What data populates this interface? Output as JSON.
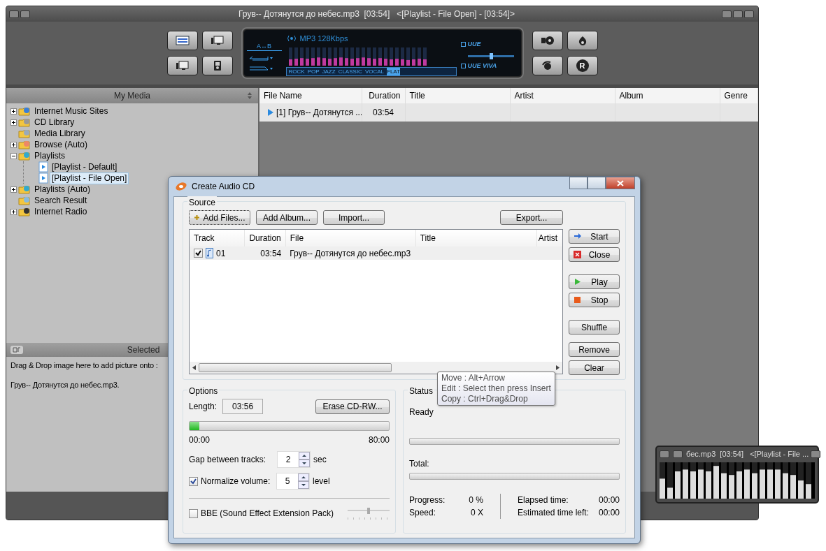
{
  "main_window": {
    "title": "Грув-- Дотянутся до небес.mp3  [03:54]   <[Playlist - File Open] - [03:54]>"
  },
  "player": {
    "format": "MP3 128Kbps",
    "ab_repeat": "A↔B",
    "presets": [
      {
        "label": "ROCK",
        "selected": false
      },
      {
        "label": "POP",
        "selected": false
      },
      {
        "label": "JAZZ",
        "selected": false
      },
      {
        "label": "CLASSIC",
        "selected": false
      },
      {
        "label": "VOCAL",
        "selected": false
      },
      {
        "label": "FLAT",
        "selected": true
      }
    ],
    "effects": [
      {
        "label": "UUE",
        "checked": false,
        "level": 0.5
      },
      {
        "label": "UUE VIVA",
        "checked": false
      }
    ],
    "r_button": "R"
  },
  "media": {
    "title": "My Media",
    "tree": [
      {
        "label": "Internet Music Sites",
        "expanded": false,
        "selected": false
      },
      {
        "label": "CD Library",
        "expanded": false,
        "selected": false
      },
      {
        "label": "Media Library",
        "selected": false
      },
      {
        "label": "Browse (Auto)",
        "expanded": false,
        "selected": false
      },
      {
        "label": "Playlists",
        "expanded": true,
        "selected": false,
        "children": [
          {
            "label": "[Playlist - Default]",
            "selected": false
          },
          {
            "label": "[Playlist - File Open]",
            "selected": true
          }
        ]
      },
      {
        "label": "Playlists (Auto)",
        "expanded": false,
        "selected": false
      },
      {
        "label": "Search Result",
        "selected": false
      },
      {
        "label": "Internet Radio",
        "expanded": false,
        "selected": false
      }
    ]
  },
  "selected_panel": {
    "title": "Selected",
    "hint": "Drag & Drop image here to add picture onto :",
    "file": "Грув-- Дотянутся до небес.mp3."
  },
  "playlist": {
    "columns": [
      "File Name",
      "Duration",
      "Title",
      "Artist",
      "Album",
      "Genre"
    ],
    "rows": [
      {
        "file_name": "[1] Грув-- Дотянутся ...",
        "duration": "03:54",
        "playing": true
      }
    ]
  },
  "cd_dialog": {
    "title": "Create Audio CD",
    "source": {
      "legend": "Source",
      "buttons": [
        "Add Files...",
        "Add Album...",
        "Import...",
        "Export..."
      ],
      "columns": [
        "Track",
        "Duration",
        "File",
        "Title",
        "Artist"
      ],
      "rows": [
        {
          "checked": true,
          "track": "01",
          "duration": "03:54",
          "file": "Грув-- Дотянутся до небес.mp3"
        }
      ]
    },
    "side_buttons": [
      "Start",
      "Close",
      "Play",
      "Stop",
      "Shuffle",
      "Remove",
      "Clear"
    ],
    "options": {
      "legend": "Options",
      "length_label": "Length:",
      "length": "03:56",
      "erase_button": "Erase CD-RW...",
      "level": 0.05,
      "scale_start": "00:00",
      "scale_end": "80:00",
      "gap": {
        "label": "Gap between tracks:",
        "value": "2",
        "unit": "sec"
      },
      "normalize": {
        "label": "Normalize volume:",
        "checked": true,
        "value": "5",
        "unit": "level"
      },
      "bbe": {
        "label": "BBE (Sound Effect Extension Pack)",
        "checked": false,
        "level": 0.5
      }
    },
    "status": {
      "legend": "Status",
      "state": "Ready",
      "current": {
        "level": 0
      },
      "total": {
        "label": "Total:",
        "level": 0
      },
      "stats": [
        {
          "label": "Progress:",
          "value": "0 %"
        },
        {
          "label": "Speed:",
          "value": "0 X"
        },
        {
          "label": "Elapsed time:",
          "value": "00:00"
        },
        {
          "label": "Estimated time left:",
          "value": "00:00"
        }
      ]
    }
  },
  "tooltip": {
    "lines": [
      "Move : Alt+Arrow",
      "Edit : Select then press Insert",
      "Copy : Ctrl+Drag&Drop"
    ]
  },
  "mini_player": {
    "title": "бес.mp3  [03:54]   <[Playlist - File ..."
  }
}
